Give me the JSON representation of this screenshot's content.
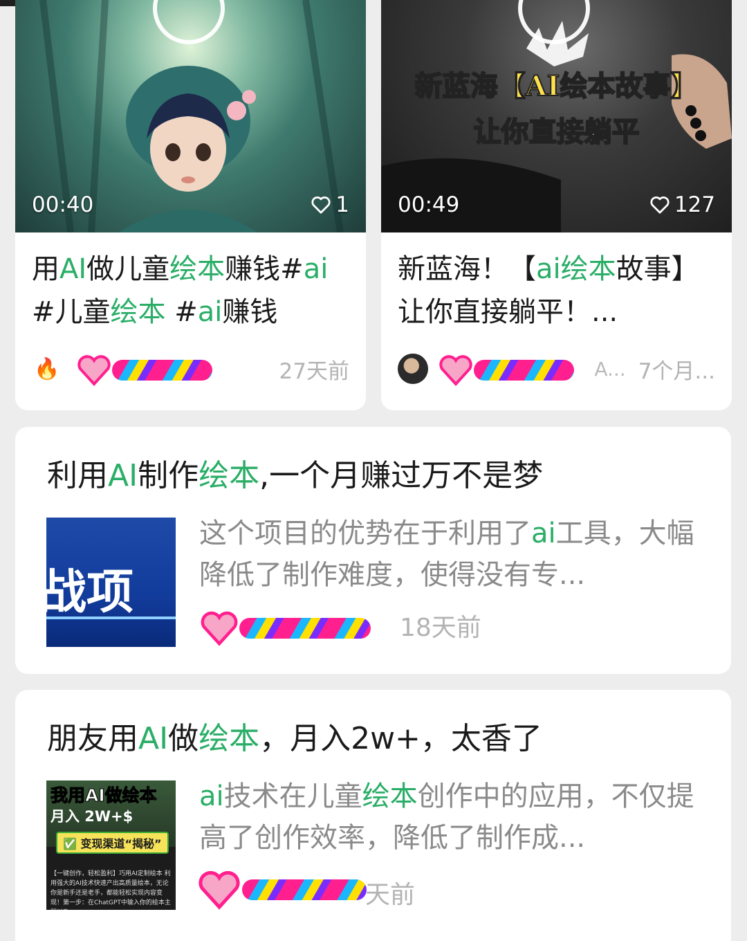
{
  "video_cards": [
    {
      "duration": "00:40",
      "likes": "1",
      "title_parts": [
        "用",
        "AI",
        "做儿童",
        "绘本",
        "赚钱#",
        "ai",
        " #儿童",
        "绘本",
        " #",
        "ai",
        "赚钱"
      ],
      "author": "",
      "time": "27天前"
    },
    {
      "duration": "00:49",
      "likes": "127",
      "overlay_line1": "新蓝海【AI绘本故事】",
      "overlay_line2": "让你直接躺平",
      "title_parts": [
        "新蓝海！【",
        "ai",
        "绘本",
        "故事】让你直接躺平！..."
      ],
      "author": "A...",
      "time": "7个月..."
    }
  ],
  "article_cards": [
    {
      "title_parts": [
        "利用",
        "AI",
        "制作",
        "绘本",
        ",一个月赚过万不是梦"
      ],
      "thumb_text": "战项",
      "desc_parts": [
        "这个项目的优势在于利用了",
        "ai",
        "工具，大幅降低了制作难度，使得没有专..."
      ],
      "time": "18天前"
    },
    {
      "title_parts": [
        "朋友用",
        "AI",
        "做",
        "绘本",
        "，月入2w+，太香了"
      ],
      "thumb_line1": "我用AI做绘本",
      "thumb_line2": "月入 2W+$",
      "thumb_line3": "✅ 变现渠道“揭秘”",
      "thumb_body": "【一键创作，轻松盈利】巧用AI定制绘本 利用强大的AI技术快速产出高质量绘本，无论你是新手还是老手，都能轻松实现内容变现！第一步：在ChatGPT中输入你的绘本主题以及",
      "desc_parts": [
        "",
        "ai",
        "技术在儿童",
        "绘本",
        "创作中的应用，不仅提高了创作效率，降低了制作成..."
      ],
      "time": "天前"
    }
  ],
  "colors": {
    "highlight": "#2aae67",
    "background": "#ededed",
    "card": "#ffffff",
    "meta_text": "#b3b3b3"
  },
  "icons": {
    "like": "heart-outline-icon",
    "avatar_1": "fire-icon",
    "play": "play-ring-icon"
  }
}
